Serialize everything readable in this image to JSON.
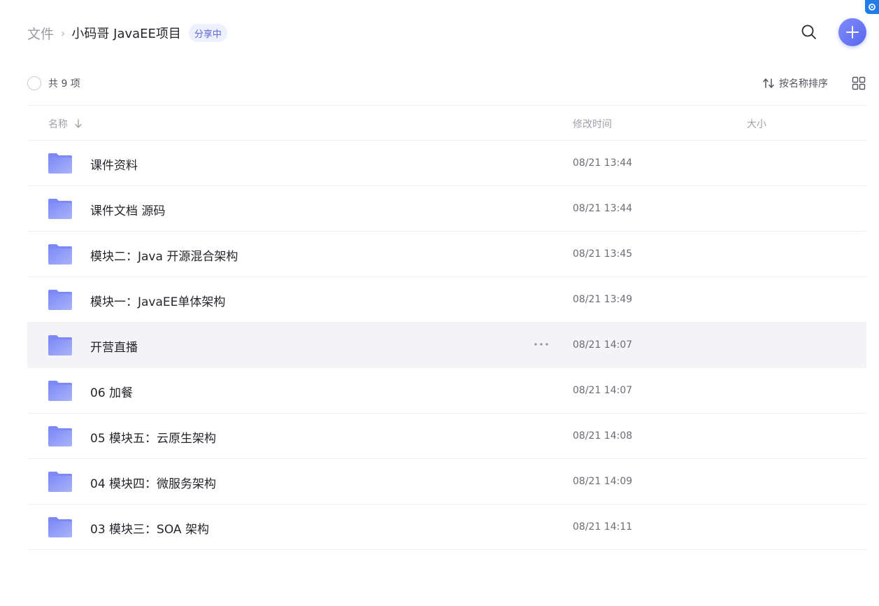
{
  "breadcrumb": {
    "root": "文件",
    "separator": "›",
    "current": "小码哥 JavaEE项目",
    "badge": "分享中"
  },
  "toolbar": {
    "count_text": "共 9 项",
    "sort_label": "按名称排序"
  },
  "columns": {
    "name": "名称",
    "modified": "修改时间",
    "size": "大小"
  },
  "files": [
    {
      "name": "课件资料",
      "modified": "08/21 13:44",
      "size": ""
    },
    {
      "name": "课件文档 源码",
      "modified": "08/21 13:44",
      "size": ""
    },
    {
      "name": "模块二：Java 开源混合架构",
      "modified": "08/21 13:45",
      "size": ""
    },
    {
      "name": "模块一：JavaEE单体架构",
      "modified": "08/21 13:49",
      "size": ""
    },
    {
      "name": "开营直播",
      "modified": "08/21 14:07",
      "size": ""
    },
    {
      "name": "06 加餐",
      "modified": "08/21 14:07",
      "size": ""
    },
    {
      "name": "05 模块五：云原生架构",
      "modified": "08/21 14:08",
      "size": ""
    },
    {
      "name": "04 模块四：微服务架构",
      "modified": "08/21 14:09",
      "size": ""
    },
    {
      "name": "03 模块三：SOA 架构",
      "modified": "08/21 14:11",
      "size": ""
    }
  ],
  "hovered_row": 4,
  "colors": {
    "accent": "#5a67ee",
    "folder_light": "#a9b3fb",
    "folder_dark": "#7d8af5",
    "hover_bg": "#f4f4f6"
  },
  "icons": [
    "search-icon",
    "plus-icon",
    "sort-icon",
    "grid-view-icon",
    "arrow-down-icon",
    "folder-icon",
    "more-icon"
  ]
}
